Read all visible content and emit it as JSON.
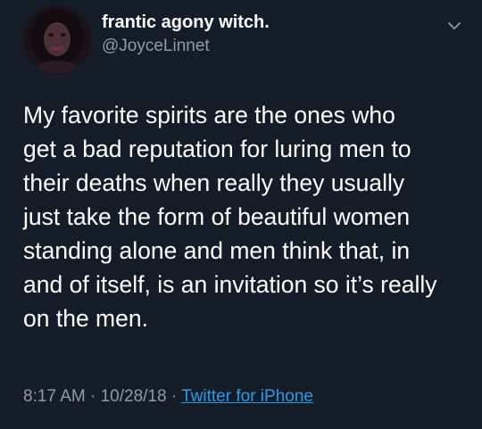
{
  "author": {
    "display_name": "frantic agony witch.",
    "handle": "@JoyceLinnet"
  },
  "tweet": {
    "lines": [
      "My favorite spirits are the ones who",
      "get a bad reputation for luring men to",
      "their deaths when really they usually",
      "just take the form of beautiful women",
      "standing alone and men think that, in",
      "and of itself, is an invitation so it’s really",
      "on the men."
    ]
  },
  "meta": {
    "time": "8:17 AM",
    "separator_1": " · ",
    "date": "10/28/18",
    "separator_2": " · ",
    "source": "Twitter for iPhone"
  },
  "colors": {
    "background": "#141d27",
    "text": "#ffffff",
    "secondary": "#8d9aa8",
    "link": "#2b9ae8"
  },
  "icons": {
    "menu": "chevron-down-icon",
    "avatar": "avatar"
  }
}
